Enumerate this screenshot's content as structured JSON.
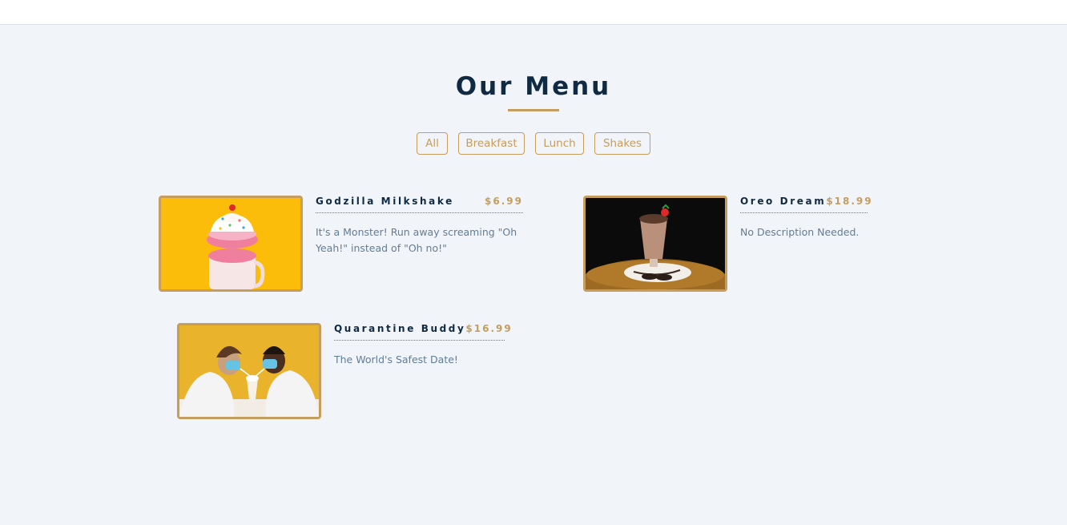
{
  "section": {
    "title": "Our Menu"
  },
  "filters": [
    {
      "label": "All"
    },
    {
      "label": "Breakfast"
    },
    {
      "label": "Lunch"
    },
    {
      "label": "Shakes"
    }
  ],
  "menu": {
    "items": [
      {
        "name": "Godzilla Milkshake",
        "price": "$6.99",
        "description": "It's a Monster! Run away screaming \"Oh Yeah!\" instead of \"Oh no!\""
      },
      {
        "name": "Oreo Dream",
        "price": "$18.99",
        "description": "No Description Needed."
      },
      {
        "name": "Quarantine Buddy",
        "price": "$16.99",
        "description": "The World's Safest Date!"
      }
    ]
  },
  "colors": {
    "accent": "#c59d5f",
    "heading": "#102a43",
    "text": "#617d98",
    "background": "#f1f4f8"
  }
}
